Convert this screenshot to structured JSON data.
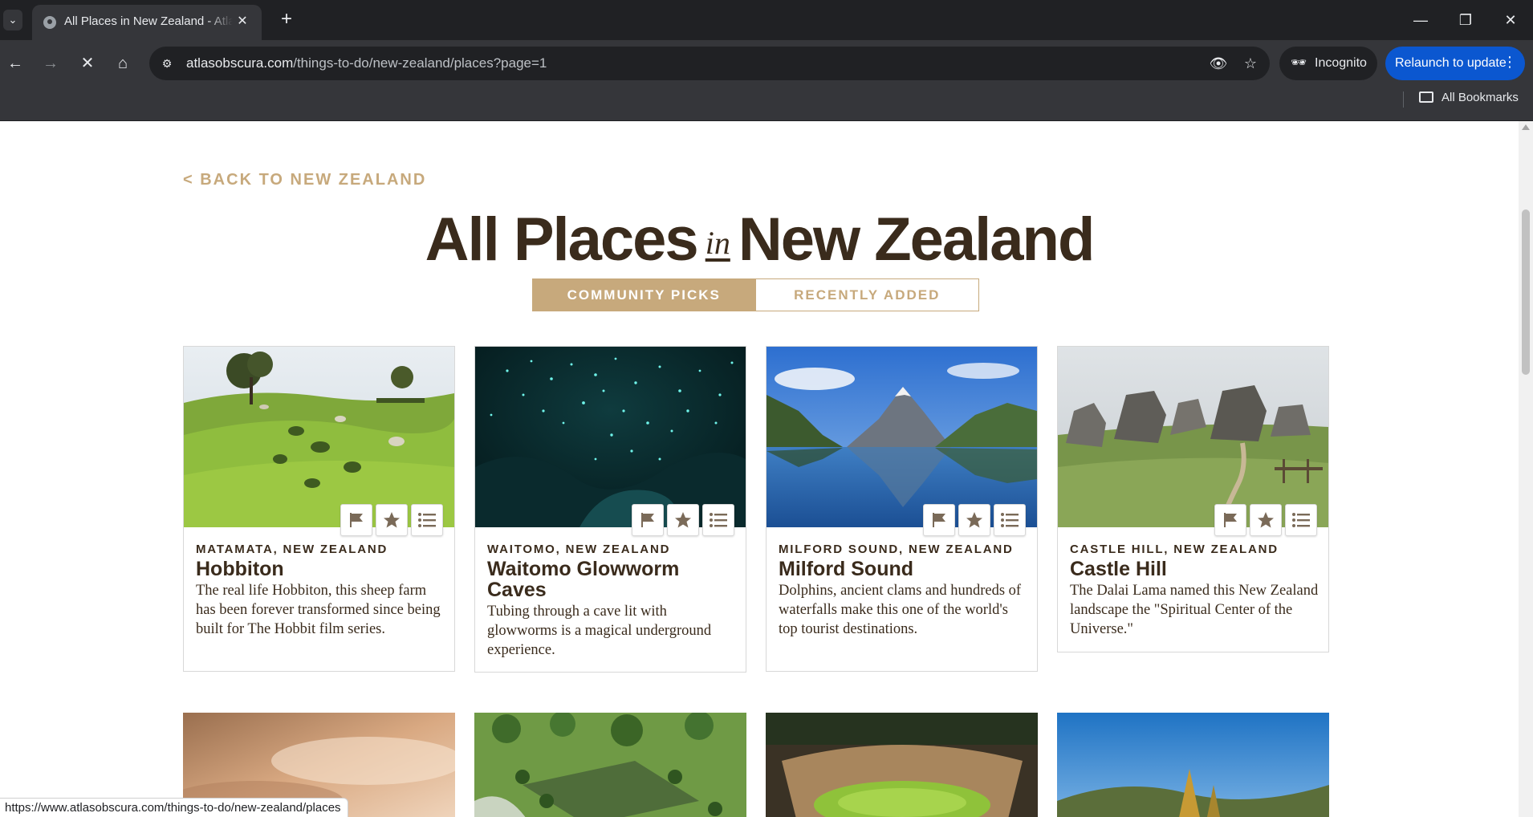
{
  "browser": {
    "tab_title": "All Places in New Zealand - Atlas Obscura",
    "url_host": "atlasobscura.com",
    "url_path": "/things-to-do/new-zealand/places?page=1",
    "incognito_label": "Incognito",
    "relaunch_label": "Relaunch to update",
    "bookmarks_label": "All Bookmarks",
    "status_url": "https://www.atlasobscura.com/things-to-do/new-zealand/places"
  },
  "page": {
    "back_link": "< BACK TO NEW ZEALAND",
    "title_part1": "All Places",
    "title_in": "in",
    "title_part2": "New Zealand",
    "tabs": [
      {
        "label": "COMMUNITY PICKS",
        "active": true
      },
      {
        "label": "RECENTLY ADDED",
        "active": false
      }
    ]
  },
  "places": [
    {
      "location": "MATAMATA, NEW ZEALAND",
      "name": "Hobbiton",
      "description": "The real life Hobbiton, this sheep farm has been forever transformed since being built for The Hobbit film series.",
      "image": "green-hills-hobbit-holes"
    },
    {
      "location": "WAITOMO, NEW ZEALAND",
      "name": "Waitomo Glowworm Caves",
      "description": "Tubing through a cave lit with glowworms is a magical underground experience.",
      "image": "glowworm-cave"
    },
    {
      "location": "MILFORD SOUND, NEW ZEALAND",
      "name": "Milford Sound",
      "description": "Dolphins, ancient clams and hundreds of waterfalls make this one of the world's top tourist destinations.",
      "image": "mountain-fjord-reflection"
    },
    {
      "location": "CASTLE HILL, NEW ZEALAND",
      "name": "Castle Hill",
      "description": "The Dalai Lama named this New Zealand landscape the \"Spiritual Center of the Universe.\"",
      "image": "limestone-boulders"
    }
  ],
  "card_actions": [
    "flag-icon",
    "star-icon",
    "list-icon"
  ],
  "colors": {
    "accent": "#c7a97c",
    "text": "#3a2b1c",
    "chrome_dark": "#202124",
    "chrome": "#35363a",
    "relaunch": "#0b57d0"
  }
}
